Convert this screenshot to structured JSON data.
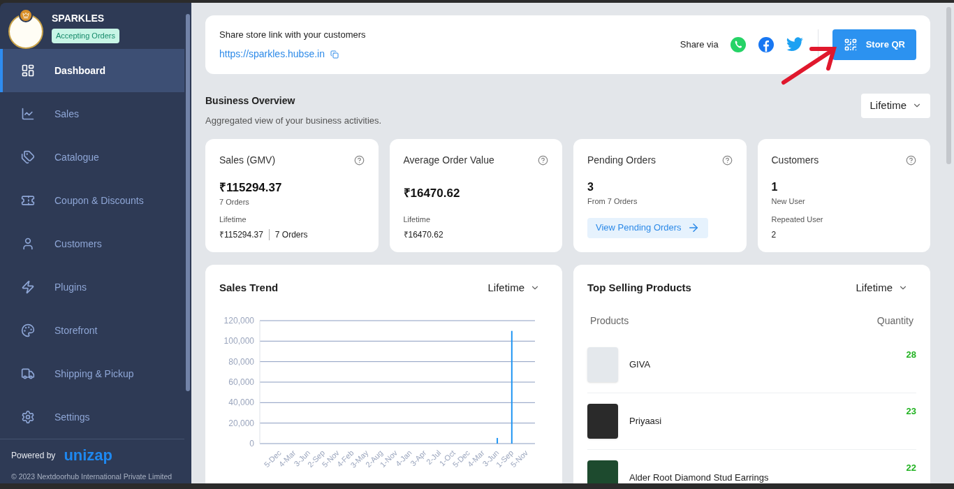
{
  "sidebar": {
    "store_name": "SPARKLES",
    "status_badge": "Accepting Orders",
    "nav_items": [
      {
        "label": "Dashboard",
        "selected": true,
        "kind": "dashboard"
      },
      {
        "label": "Sales",
        "selected": false,
        "kind": "sales"
      },
      {
        "label": "Catalogue",
        "selected": false,
        "kind": "catalogue"
      },
      {
        "label": "Coupon & Discounts",
        "selected": false,
        "kind": "coupon"
      },
      {
        "label": "Customers",
        "selected": false,
        "kind": "customers"
      },
      {
        "label": "Plugins",
        "selected": false,
        "kind": "plugins"
      },
      {
        "label": "Storefront",
        "selected": false,
        "kind": "storefront"
      },
      {
        "label": "Shipping & Pickup",
        "selected": false,
        "kind": "shipping"
      },
      {
        "label": "Settings",
        "selected": false,
        "kind": "settings"
      }
    ],
    "powered_by": "Powered by",
    "brand": "unizap",
    "copyright": "© 2023 Nextdoorhub International Private Limited"
  },
  "share": {
    "heading": "Share store link with your customers",
    "link": "https://sparkles.hubse.in",
    "share_label": "Share via",
    "button": "Store QR"
  },
  "overview": {
    "title": "Business Overview",
    "subtitle": "Aggregated view of your business activities.",
    "period": "Lifetime"
  },
  "stats": [
    {
      "kind": "split",
      "title": "Sales (GMV)",
      "value": "₹115294.37",
      "caption": "7 Orders",
      "footer_label": "Lifetime",
      "footer_values": [
        "₹115294.37",
        "7 Orders"
      ]
    },
    {
      "kind": "split",
      "title": "Average Order Value",
      "value": "₹16470.62",
      "footer_label": "Lifetime",
      "footer_values": [
        "₹16470.62"
      ]
    },
    {
      "kind": "action",
      "title": "Pending Orders",
      "value": "3",
      "caption": "From 7 Orders",
      "action": "View Pending Orders"
    },
    {
      "kind": "users",
      "title": "Customers",
      "value": "1",
      "caption": "New User",
      "footer_label": "Repeated User",
      "footer_values": [
        "2"
      ]
    }
  ],
  "sales_trend": {
    "title": "Sales Trend",
    "period": "Lifetime",
    "chart_data": {
      "type": "bar",
      "categories": [
        "5-Dec",
        "4-Mar",
        "3-Jun",
        "2-Sep",
        "5-Nov",
        "4-Feb",
        "3-May",
        "2-Aug",
        "1-Nov",
        "4-Jan",
        "3-Apr",
        "2-Jul",
        "1-Oct",
        "5-Dec",
        "4-Mar",
        "3-Jun",
        "1-Sep",
        "5-Nov"
      ],
      "grid": true,
      "series": [
        {
          "color": "#2196f3",
          "values": [
            0,
            0,
            0,
            0,
            0,
            0,
            0,
            0,
            0,
            0,
            0,
            0,
            0,
            0,
            0,
            5500,
            110000,
            0
          ]
        }
      ],
      "ylim": [
        0,
        120000
      ],
      "yticks": [
        {
          "value": 0,
          "label": "0"
        },
        {
          "value": 20000,
          "label": "20,000"
        },
        {
          "value": 40000,
          "label": "40,000"
        },
        {
          "value": 60000,
          "label": "60,000"
        },
        {
          "value": 80000,
          "label": "80,000"
        },
        {
          "value": 100000,
          "label": "100,000"
        },
        {
          "value": 120000,
          "label": "120,000"
        }
      ]
    }
  },
  "top_products": {
    "title": "Top Selling Products",
    "period": "Lifetime",
    "columns": [
      "Products",
      "Quantity"
    ],
    "rows": [
      {
        "name": "GIVA",
        "quantity": "28"
      },
      {
        "name": "Priyaasi",
        "quantity": "23"
      },
      {
        "name": "Alder Root Diamond Stud Earrings",
        "quantity": "22"
      }
    ]
  }
}
